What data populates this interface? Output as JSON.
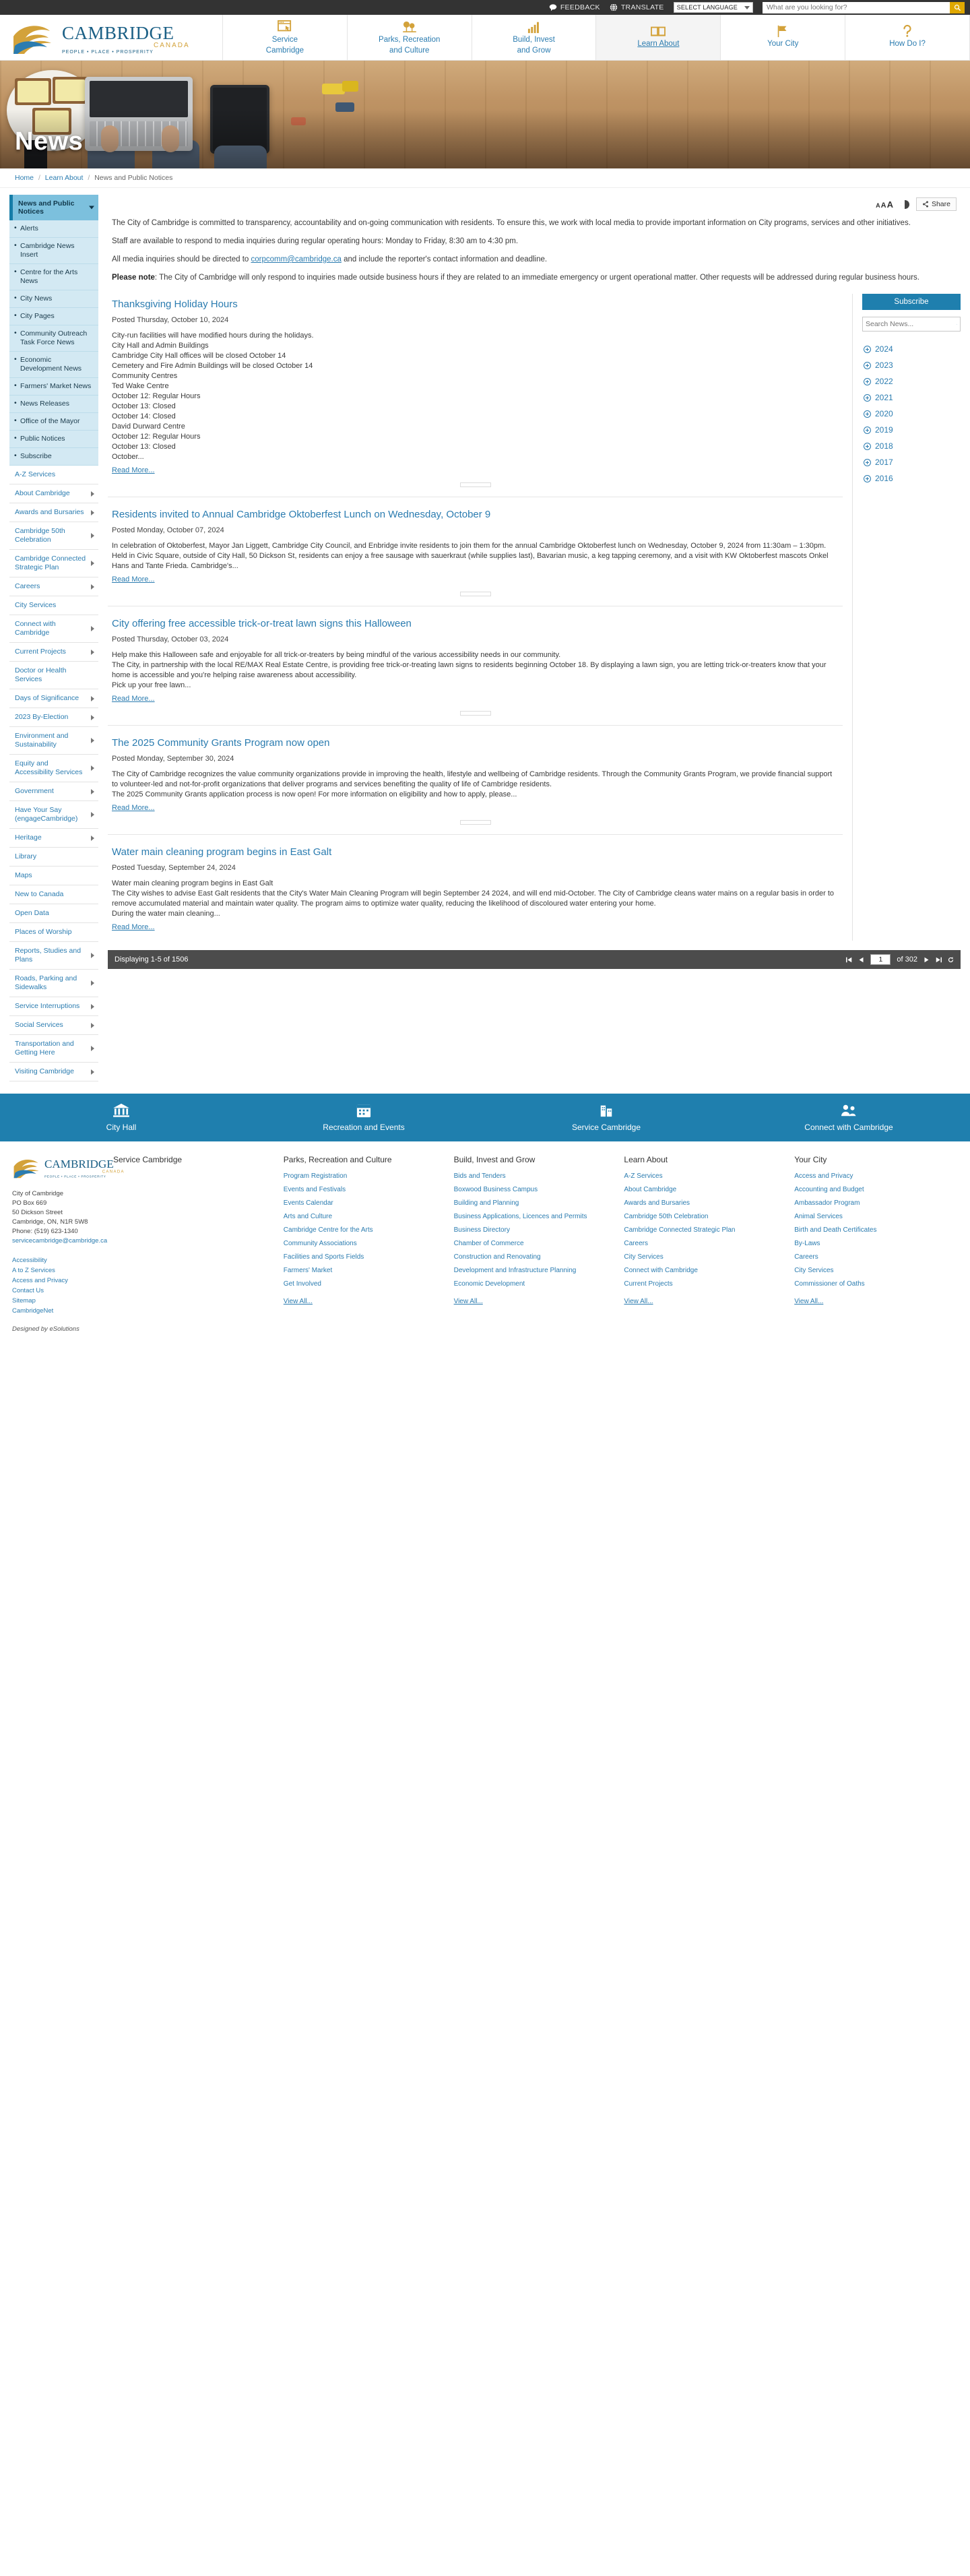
{
  "utility": {
    "feedback": "FEEDBACK",
    "translate": "TRANSLATE",
    "language_selected": "SELECT LANGUAGE",
    "search_placeholder": "What are you looking for?",
    "search_value": ""
  },
  "brand": {
    "name": "CAMBRIDGE",
    "country": "CANADA",
    "tagline": "PEOPLE • PLACE • PROSPERITY"
  },
  "mainnav": [
    {
      "label_line1": "Service",
      "label_line2": "Cambridge",
      "icon": "window-click-icon",
      "active": false
    },
    {
      "label_line1": "Parks, Recreation",
      "label_line2": "and Culture",
      "icon": "trees-icon",
      "active": false
    },
    {
      "label_line1": "Build, Invest",
      "label_line2": "and Grow",
      "icon": "bar-chart-icon",
      "active": false
    },
    {
      "label_line1": "Learn About",
      "label_line2": "",
      "icon": "book-icon",
      "active": true
    },
    {
      "label_line1": "Your City",
      "label_line2": "",
      "icon": "flag-icon",
      "active": false
    },
    {
      "label_line1": "How Do I?",
      "label_line2": "",
      "icon": "question-icon",
      "active": false
    }
  ],
  "hero": {
    "title": "News"
  },
  "breadcrumb": [
    {
      "label": "Home",
      "link": true
    },
    {
      "label": "Learn About",
      "link": true
    },
    {
      "label": "News and Public Notices",
      "link": false
    }
  ],
  "content_tools": {
    "text_small": "A",
    "text_medium": "A",
    "text_large": "A",
    "contrast_icon": "contrast-icon",
    "share_label": "Share",
    "share_icon": "share-icon"
  },
  "intro": {
    "p1": "The City of Cambridge is committed to transparency, accountability and on-going communication with residents. To ensure this, we work with local media to provide important information on City programs, services and other initiatives.",
    "p2": "Staff are available to respond to media inquiries during regular operating hours: Monday to Friday, 8:30 am to 4:30 pm.",
    "p3_pre": "All media inquiries should be directed to ",
    "p3_email": "corpcomm@cambridge.ca",
    "p3_post": " and include the reporter's contact information and deadline.",
    "p4_label": "Please note",
    "p4_text": ": The City of Cambridge will only respond to inquiries made outside business hours if they are related to an immediate emergency or urgent operational matter. Other requests will be addressed during regular business hours."
  },
  "sidebar": {
    "heading": "News and Public Notices",
    "sub_items": [
      "Alerts",
      "Cambridge News Insert",
      "Centre for the Arts News",
      "City News",
      "City Pages",
      "Community Outreach Task Force News",
      "Economic Development News",
      "Farmers' Market News",
      "News Releases",
      "Office of the Mayor",
      "Public Notices",
      "Subscribe"
    ],
    "links": [
      {
        "label": "A-Z Services",
        "arrow": false
      },
      {
        "label": "About Cambridge",
        "arrow": true
      },
      {
        "label": "Awards and Bursaries",
        "arrow": true
      },
      {
        "label": "Cambridge 50th Celebration",
        "arrow": true
      },
      {
        "label": "Cambridge Connected Strategic Plan",
        "arrow": true
      },
      {
        "label": "Careers",
        "arrow": true
      },
      {
        "label": "City Services",
        "arrow": false
      },
      {
        "label": "Connect with Cambridge",
        "arrow": true
      },
      {
        "label": "Current Projects",
        "arrow": true
      },
      {
        "label": "Doctor or Health Services",
        "arrow": false
      },
      {
        "label": "Days of Significance",
        "arrow": true
      },
      {
        "label": "2023 By-Election",
        "arrow": true
      },
      {
        "label": "Environment and Sustainability",
        "arrow": true
      },
      {
        "label": "Equity and Accessibility Services",
        "arrow": true
      },
      {
        "label": "Government",
        "arrow": true
      },
      {
        "label": "Have Your Say (engageCambridge)",
        "arrow": true
      },
      {
        "label": "Heritage",
        "arrow": true
      },
      {
        "label": "Library",
        "arrow": false
      },
      {
        "label": "Maps",
        "arrow": false
      },
      {
        "label": "New to Canada",
        "arrow": false
      },
      {
        "label": "Open Data",
        "arrow": false
      },
      {
        "label": "Places of Worship",
        "arrow": false
      },
      {
        "label": "Reports, Studies and Plans",
        "arrow": true
      },
      {
        "label": "Roads, Parking and Sidewalks",
        "arrow": true
      },
      {
        "label": "Service Interruptions",
        "arrow": true
      },
      {
        "label": "Social Services",
        "arrow": true
      },
      {
        "label": "Transportation and Getting Here",
        "arrow": true
      },
      {
        "label": "Visiting Cambridge",
        "arrow": true
      }
    ]
  },
  "news": [
    {
      "title": "Thanksgiving Holiday Hours",
      "date": "Posted Thursday, October 10, 2024",
      "body": "City-run facilities will have modified hours during the holidays.\nCity Hall and Admin Buildings\n   Cambridge City Hall offices will be closed October 14\n Cemetery and Fire Admin Buildings will be closed October 14\n   Community Centres\n   Ted Wake Centre\nOctober 12: Regular Hours\nOctober 13: Closed\nOctober 14: Closed\n   David Durward Centre\nOctober 12: Regular Hours\nOctober 13: Closed\nOctober...",
      "read_more": "Read More..."
    },
    {
      "title": "Residents invited to Annual Cambridge Oktoberfest Lunch on Wednesday, October 9",
      "date": "Posted Monday, October 07, 2024",
      "body": "In celebration of Oktoberfest, Mayor Jan Liggett, Cambridge City Council, and Enbridge invite residents to join them for the annual Cambridge Oktoberfest lunch on Wednesday, October 9, 2024 from 11:30am – 1:30pm.\nHeld in Civic Square, outside of City Hall, 50 Dickson St, residents can enjoy a free sausage with sauerkraut (while supplies last), Bavarian music, a keg tapping ceremony, and a visit with KW Oktoberfest mascots Onkel Hans and Tante Frieda. Cambridge's...",
      "read_more": "Read More..."
    },
    {
      "title": "City offering free accessible trick-or-treat lawn signs this Halloween",
      "date": "Posted Thursday, October 03, 2024",
      "body": "Help make this Halloween safe and enjoyable for all trick-or-treaters by being mindful of the various accessibility needs in our community.\nThe City, in partnership with the local RE/MAX Real Estate Centre, is providing free trick-or-treating lawn signs to residents beginning October 18. By displaying a lawn sign, you are letting trick-or-treaters know that your home is accessible and you're helping raise awareness about accessibility.\nPick up your free lawn...",
      "read_more": "Read More..."
    },
    {
      "title": "The 2025 Community Grants Program now open",
      "date": "Posted Monday, September 30, 2024",
      "body": "The City of Cambridge recognizes the value community organizations provide in improving the health, lifestyle and wellbeing of Cambridge residents. Through the Community Grants Program, we provide financial support to volunteer-led and not-for-profit organizations that deliver programs and services benefiting the quality of life of Cambridge residents.\nThe 2025 Community Grants application process is now open! For more information on eligibility and how to apply, please...",
      "read_more": "Read More..."
    },
    {
      "title": "Water main cleaning program begins in East Galt",
      "date": "Posted Tuesday, September 24, 2024",
      "body": "Water main cleaning program begins in East Galt\nThe City wishes to advise East Galt residents that the City's Water Main Cleaning Program will begin September 24 2024, and will end mid-October. The City of Cambridge cleans water mains on a regular basis in order to remove accumulated material and maintain water quality. The program aims to optimize water quality, reducing the likelihood of discoloured water entering your home.\nDuring the water main cleaning...",
      "read_more": "Read More..."
    }
  ],
  "aside": {
    "subscribe_label": "Subscribe",
    "search_placeholder": "Search News...",
    "search_icon": "search-icon",
    "years": [
      "2024",
      "2023",
      "2022",
      "2021",
      "2020",
      "2019",
      "2018",
      "2017",
      "2016"
    ]
  },
  "pager": {
    "displaying": "Displaying 1-5 of 1506",
    "page_value": "1",
    "of_label": "of 302",
    "first_icon": "first-page-icon",
    "prev_icon": "prev-page-icon",
    "next_icon": "next-page-icon",
    "last_icon": "last-page-icon",
    "refresh_icon": "refresh-icon"
  },
  "quicklinks": [
    {
      "label": "City Hall",
      "icon": "city-hall-icon"
    },
    {
      "label": "Recreation and Events",
      "icon": "calendar-icon"
    },
    {
      "label": "Service Cambridge",
      "icon": "building-icon"
    },
    {
      "label": "Connect with Cambridge",
      "icon": "people-icon"
    }
  ],
  "footer": {
    "address": {
      "org": "City of Cambridge",
      "box": "PO Box 669",
      "street": "50 Dickson Street",
      "city": "Cambridge, ON, N1R 5W8",
      "phone": "Phone: (519) 623-1340",
      "email": "servicecambridge@cambridge.ca"
    },
    "utility_links": [
      "Accessibility",
      "A to Z Services",
      "Access and Privacy",
      "Contact Us",
      "Sitemap",
      "CambridgeNet"
    ],
    "credit": "Designed by eSolutions",
    "columns": [
      {
        "title": "Service Cambridge",
        "links": [],
        "view_all": ""
      },
      {
        "title": "Parks, Recreation and Culture",
        "links": [
          "Program Registration",
          "Events and Festivals",
          "Events Calendar",
          "Arts and Culture",
          "Cambridge Centre for the Arts",
          "Community Associations",
          "Facilities and Sports Fields",
          "Farmers' Market",
          "Get Involved"
        ],
        "view_all": "View All..."
      },
      {
        "title": "Build, Invest and Grow",
        "links": [
          "Bids and Tenders",
          "Boxwood Business Campus",
          "Building and Planning",
          "Business Applications, Licences and Permits",
          "Business Directory",
          "Chamber of Commerce",
          "Construction and Renovating",
          "Development and Infrastructure Planning",
          "Economic Development"
        ],
        "view_all": "View All..."
      },
      {
        "title": "Learn About",
        "links": [
          "A-Z Services",
          "About Cambridge",
          "Awards and Bursaries",
          "Cambridge 50th Celebration",
          "Cambridge Connected Strategic Plan",
          "Careers",
          "City Services",
          "Connect with Cambridge",
          "Current Projects"
        ],
        "view_all": "View All..."
      },
      {
        "title": "Your City",
        "links": [
          "Access and Privacy",
          "Accounting and Budget",
          "Ambassador Program",
          "Animal Services",
          "Birth and Death Certificates",
          "By-Laws",
          "Careers",
          "City Services",
          "Commissioner of Oaths"
        ],
        "view_all": "View All..."
      }
    ]
  },
  "colors": {
    "brand_blue": "#1f7fae",
    "link_blue": "#2b7cb0",
    "accent_gold": "#d3a23a",
    "dark_bar": "#333333",
    "sidebar_sub": "#d3e9f3"
  }
}
